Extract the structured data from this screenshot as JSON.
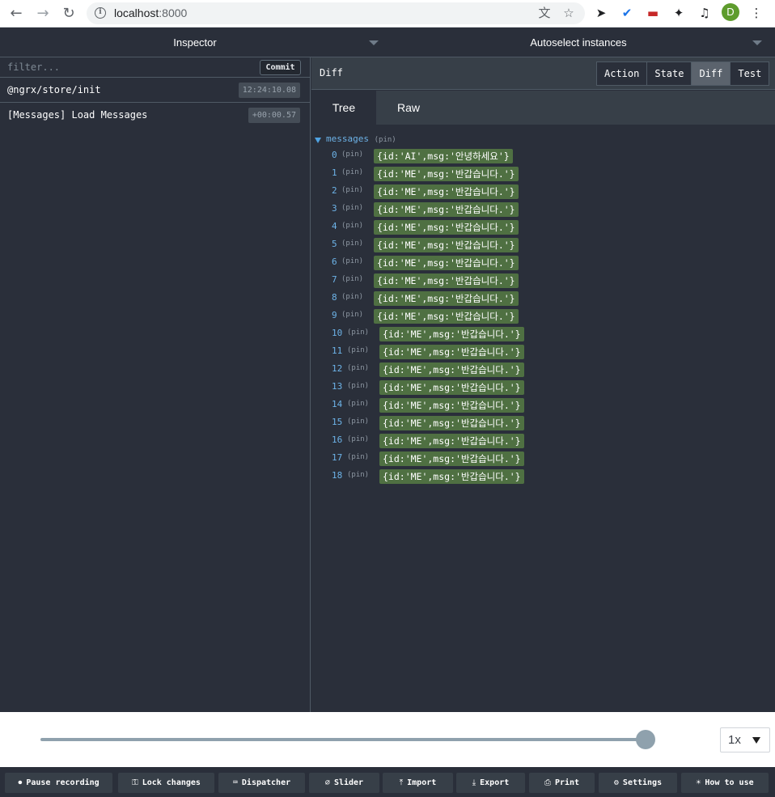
{
  "browser": {
    "url_host": "localhost",
    "url_port": ":8000",
    "avatar_initial": "D"
  },
  "devtools": {
    "inspector_label": "Inspector",
    "instances_label": "Autoselect instances"
  },
  "actions_panel": {
    "filter_placeholder": "filter...",
    "commit_label": "Commit",
    "actions": [
      {
        "name": "@ngrx/store/init",
        "time": "12:24:10.08"
      },
      {
        "name": "[Messages] Load Messages",
        "time": "+00:00.57"
      }
    ]
  },
  "monitor": {
    "title": "Diff",
    "tabs": [
      "Action",
      "State",
      "Diff",
      "Test"
    ],
    "active_tab": "Diff",
    "view_tabs": [
      "Tree",
      "Raw"
    ],
    "active_view": "Tree"
  },
  "tree": {
    "root_key": "messages",
    "pin_label": "(pin)",
    "items": [
      {
        "index": "0",
        "value": "{id:'AI',msg:'안녕하세요'}"
      },
      {
        "index": "1",
        "value": "{id:'ME',msg:'반갑습니다.'}"
      },
      {
        "index": "2",
        "value": "{id:'ME',msg:'반갑습니다.'}"
      },
      {
        "index": "3",
        "value": "{id:'ME',msg:'반갑습니다.'}"
      },
      {
        "index": "4",
        "value": "{id:'ME',msg:'반갑습니다.'}"
      },
      {
        "index": "5",
        "value": "{id:'ME',msg:'반갑습니다.'}"
      },
      {
        "index": "6",
        "value": "{id:'ME',msg:'반갑습니다.'}"
      },
      {
        "index": "7",
        "value": "{id:'ME',msg:'반갑습니다.'}"
      },
      {
        "index": "8",
        "value": "{id:'ME',msg:'반갑습니다.'}"
      },
      {
        "index": "9",
        "value": "{id:'ME',msg:'반갑습니다.'}"
      },
      {
        "index": "10",
        "value": "{id:'ME',msg:'반갑습니다.'}"
      },
      {
        "index": "11",
        "value": "{id:'ME',msg:'반갑습니다.'}"
      },
      {
        "index": "12",
        "value": "{id:'ME',msg:'반갑습니다.'}"
      },
      {
        "index": "13",
        "value": "{id:'ME',msg:'반갑습니다.'}"
      },
      {
        "index": "14",
        "value": "{id:'ME',msg:'반갑습니다.'}"
      },
      {
        "index": "15",
        "value": "{id:'ME',msg:'반갑습니다.'}"
      },
      {
        "index": "16",
        "value": "{id:'ME',msg:'반갑습니다.'}"
      },
      {
        "index": "17",
        "value": "{id:'ME',msg:'반갑습니다.'}"
      },
      {
        "index": "18",
        "value": "{id:'ME',msg:'반갑습니다.'}"
      }
    ]
  },
  "slider": {
    "position": 1.0,
    "speed": "1x"
  },
  "toolbar": {
    "buttons": [
      {
        "label": "Pause recording",
        "icon": "pause-circle-icon"
      },
      {
        "label": "Lock changes",
        "icon": "lock-icon"
      },
      {
        "label": "Dispatcher",
        "icon": "keyboard-icon"
      },
      {
        "label": "Slider",
        "icon": "slider-off-icon"
      },
      {
        "label": "Import",
        "icon": "upload-icon"
      },
      {
        "label": "Export",
        "icon": "download-icon"
      },
      {
        "label": "Print",
        "icon": "print-icon"
      },
      {
        "label": "Settings",
        "icon": "gear-icon"
      },
      {
        "label": "How to use",
        "icon": "lightbulb-icon"
      }
    ]
  },
  "colors": {
    "panel_bg": "#2a2f3a",
    "value_bg": "#4f7042",
    "key_color": "#6db3e8"
  }
}
